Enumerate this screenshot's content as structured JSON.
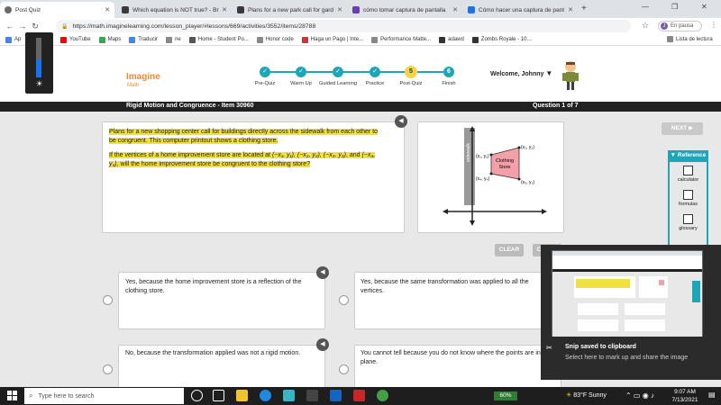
{
  "browser": {
    "tabs": [
      {
        "title": "Post Quiz",
        "color": "#6a6a6a",
        "active": true
      },
      {
        "title": "Which equation is NOT true? - Br",
        "color": "#3a3a3a",
        "active": false
      },
      {
        "title": "Plans for a new park call for gard",
        "color": "#3a3a3a",
        "active": false
      },
      {
        "title": "cómo tomar captura de pantalla",
        "color": "#6a3db8",
        "active": false
      },
      {
        "title": "Cómo hacer una captura de pant",
        "color": "#1a73e8",
        "active": false
      }
    ],
    "url": "https://math.imaginelearning.com/lesson_player/#lessons/669/activities/3552/items/28788",
    "profile_label": "En pausa",
    "profile_initial": "J",
    "bookmarks": [
      {
        "label": "Ap",
        "color": "#4285f4"
      },
      {
        "label": "Gmail",
        "color": "#ea4335"
      },
      {
        "label": "YouTube",
        "color": "#ff0000"
      },
      {
        "label": "Maps",
        "color": "#34a853"
      },
      {
        "label": "Traducir",
        "color": "#4285f4"
      },
      {
        "label": "ne",
        "color": "#888"
      },
      {
        "label": "Home - Student Po...",
        "color": "#555"
      },
      {
        "label": "Honor code",
        "color": "#888"
      },
      {
        "label": "Haga un Pago | Inte...",
        "color": "#c33"
      },
      {
        "label": "Performance Matte...",
        "color": "#888"
      },
      {
        "label": "adawd",
        "color": "#333"
      },
      {
        "label": "Zombs Royale - 10...",
        "color": "#333"
      }
    ],
    "reading_list": "Lista de lectura"
  },
  "brightness_level": 0.45,
  "header": {
    "logo": "Imagine",
    "logo_sub": "Math",
    "steps": [
      {
        "label": "Pre-Quiz",
        "mark": "✓"
      },
      {
        "label": "Warm Up",
        "mark": "✓"
      },
      {
        "label": "Guided Learning",
        "mark": "✓"
      },
      {
        "label": "Practice",
        "mark": "✓"
      },
      {
        "label": "Post-Quiz",
        "mark": "5"
      },
      {
        "label": "Finish",
        "mark": "6"
      }
    ],
    "welcome": "Welcome, Johnny"
  },
  "titlebar": {
    "title": "Rigid Motion and Congruence - Item 30960",
    "question": "Question 1 of 7"
  },
  "question": {
    "p1": "Plans for a new shopping center call for buildings directly across the sidewalk from each other to be congruent. This computer printout shows a clothing store.",
    "p2_pre": "If the vertices of a home improvement store are located at",
    "p2_post": "will the home improvement store be congruent to the clothing store?"
  },
  "figure": {
    "sidewalk": "sidewalk",
    "store": [
      "Clothing",
      "Store"
    ],
    "pts": [
      "(x₁, y₁)",
      "(x₂, y₂)",
      "(x₃, y₃)",
      "(x₄, y₄)"
    ]
  },
  "nav": {
    "next": "NEXT ▶",
    "clear": "CLEAR",
    "check": "CHECK"
  },
  "reference": {
    "title": "Reference",
    "items": [
      "calculator",
      "formulas",
      "glossary"
    ]
  },
  "answers": [
    "Yes, because the home improvement store is a reflection of the clothing store.",
    "Yes, because the same transformation was applied to all the vertices.",
    "No, because the transformation applied was not a rigid motion.",
    "You cannot tell because you do not know where the points are in the plane."
  ],
  "snip": {
    "title": "Snip saved to clipboard",
    "body": "Select here to mark up and share the image"
  },
  "taskbar": {
    "search": "Type here to search",
    "battery": "60%",
    "weather": "83°F  Sunny",
    "time": "9:07 AM",
    "date": "7/13/2021"
  }
}
